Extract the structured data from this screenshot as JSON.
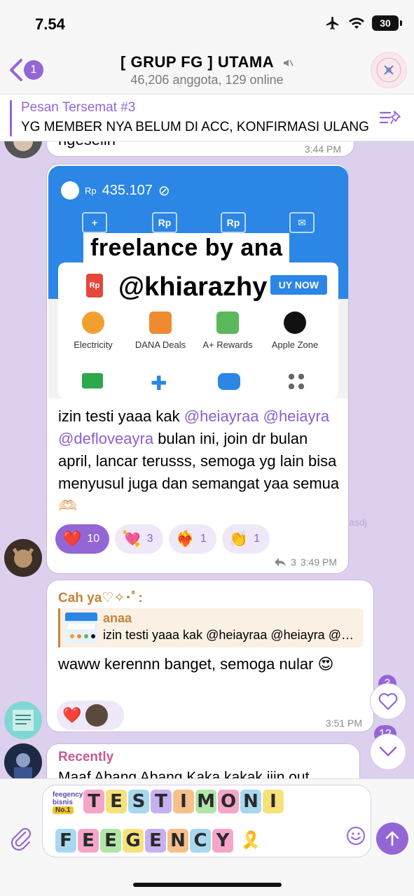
{
  "status_bar": {
    "time": "7.54",
    "battery": "30"
  },
  "header": {
    "back_badge": "1",
    "title": "[ GRUP FG ] UTAMA",
    "subtitle": "46,206 anggota, 129 online"
  },
  "pinned": {
    "title": "Pesan Tersemat #3",
    "text": "YG MEMBER NYA BELUM DI ACC, KONFIRMASI ULANG"
  },
  "messages": {
    "top_partial": {
      "text": "ngeselin",
      "time": "3:44 PM"
    },
    "media_msg": {
      "image_text": {
        "balance_prefix": "Rp",
        "balance": "435.107",
        "overlay_line1": "freelance by ana",
        "overlay_line2": "@khiarazhy",
        "buy_now": "UY NOW",
        "items": [
          {
            "label": "Electricity"
          },
          {
            "label": "DANA Deals"
          },
          {
            "label": "A+ Rewards"
          },
          {
            "label": "Apple Zone"
          }
        ]
      },
      "text_before": "izin testi yaaa kak ",
      "mention1": "@heiayraa",
      "mention2": "@heiayra",
      "mention3": "@defloveayra",
      "text_after": " bulan ini, join dr bulan april, lancar terusss, semoga yg lain bisa menyusul juga dan semangat yaa semua🫶🏻",
      "reactions": [
        {
          "emoji": "❤️",
          "count": "10"
        },
        {
          "emoji": "💘",
          "count": "3"
        },
        {
          "emoji": "❤️‍🔥",
          "count": "1"
        },
        {
          "emoji": "👏",
          "count": "1"
        }
      ],
      "replies": "3",
      "time": "3:49 PM",
      "faded_name": "asdj"
    },
    "reply_msg": {
      "sender": "Cah ya♡✧･ﾟ:",
      "quote_name": "anaa",
      "quote_text": "izin testi yaaa kak @heiayraa @heiayra @defloveayra",
      "text": "waww kerennn banget, semoga nular 😍",
      "reaction_emoji": "❤️",
      "time": "3:51 PM"
    },
    "recent_msg": {
      "sender": "Recently",
      "text": "Maaf Abang Abang Kaka kakak ijin out"
    }
  },
  "fabs": {
    "reactions_count": "3",
    "unread_count": "12"
  },
  "composer": {
    "sticker_tag_line1": "feegency",
    "sticker_tag_line2": "bisnis",
    "sticker_tag_badge": "No.1",
    "line1": [
      "T",
      "E",
      "S",
      "T",
      "I",
      "M",
      "O",
      "N",
      "I"
    ],
    "line2": [
      "F",
      "E",
      "E",
      "G",
      "E",
      "N",
      "C",
      "Y"
    ],
    "line2_trail": "🎗️"
  },
  "colors": {
    "accent": "#9366d6",
    "chat_bg": "#dcd0ee",
    "orange_name": "#c7823a",
    "pink_name": "#c75a92"
  }
}
